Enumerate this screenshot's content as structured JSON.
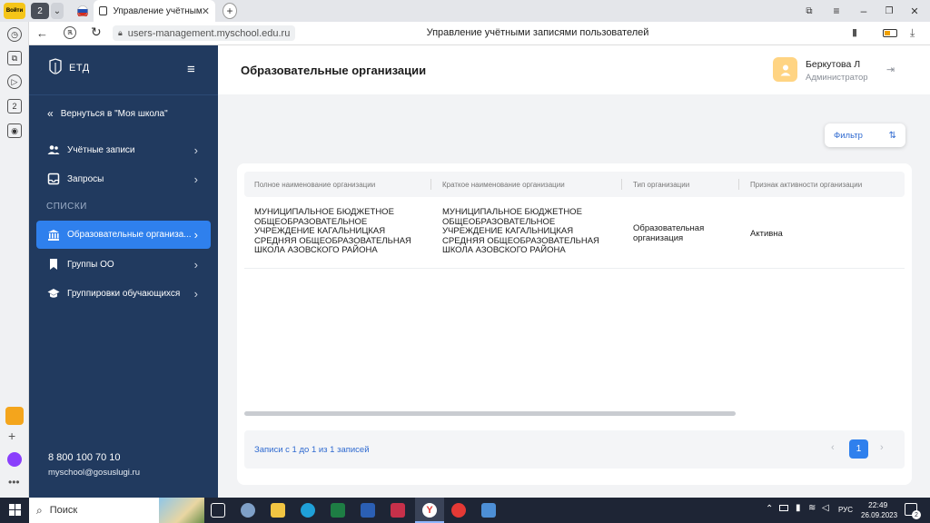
{
  "browser": {
    "tab_counter": "2",
    "tab_title": "Управление учётными",
    "address": "users-management.myschool.edu.ru",
    "page_title": "Управление учётными записями пользователей"
  },
  "sidebar": {
    "logo_text": "ЕТД",
    "back_label": "Вернуться в \"Моя школа\"",
    "items": [
      {
        "label": "Учётные записи"
      },
      {
        "label": "Запросы"
      }
    ],
    "section_title": "СПИСКИ",
    "list_items": [
      {
        "label": "Образовательные организа..."
      },
      {
        "label": "Группы ОО"
      },
      {
        "label": "Группировки обучающихся"
      }
    ],
    "phone": "8 800 100 70 10",
    "email": "myschool@gosuslugi.ru"
  },
  "header": {
    "title": "Образовательные организации",
    "user_name": "Беркутова Л",
    "user_role": "Администратор"
  },
  "filter": {
    "label": "Фильтр"
  },
  "table": {
    "columns": [
      "Полное наименование организации",
      "Краткое наименование организации",
      "Тип организации",
      "Признак активности организации"
    ],
    "rows": [
      {
        "full_name": "МУНИЦИПАЛЬНОЕ БЮДЖЕТНОЕ ОБЩЕОБРАЗОВАТЕЛЬНОЕ УЧРЕЖДЕНИЕ КАГАЛЬНИЦКАЯ СРЕДНЯЯ ОБЩЕОБРАЗОВАТЕЛЬНАЯ ШКОЛА АЗОВСКОГО РАЙОНА",
        "short_name": "МУНИЦИПАЛЬНОЕ БЮДЖЕТНОЕ ОБЩЕОБРАЗОВАТЕЛЬНОЕ УЧРЕЖДЕНИЕ КАГАЛЬНИЦКАЯ СРЕДНЯЯ ОБЩЕОБРАЗОВАТЕЛЬНАЯ ШКОЛА АЗОВСКОГО РАЙОНА",
        "type": "Образовательная организация",
        "status": "Активна"
      }
    ]
  },
  "pagination": {
    "summary": "Записи с 1 до 1 из 1 записей",
    "current_page": "1"
  },
  "taskbar": {
    "search_label": "Поиск",
    "lang": "РУС",
    "time": "22:49",
    "date": "26.09.2023",
    "notif_count": "2"
  },
  "colors": {
    "sidebar_bg": "#213a5f",
    "active_item": "#2f80ed",
    "accent": "#2f6ad0"
  }
}
